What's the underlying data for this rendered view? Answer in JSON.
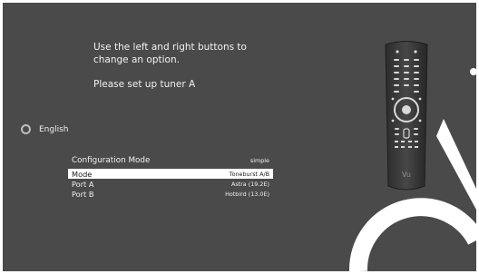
{
  "instructions": {
    "line1": "Use the left and right buttons to",
    "line2": "change an option.",
    "tuner_prompt": "Please set up tuner A"
  },
  "language": {
    "label": "English",
    "icon": "radio-icon"
  },
  "config": {
    "rows": [
      {
        "label": "Configuration Mode",
        "value": "simple"
      },
      {
        "label": "Mode",
        "value": "Toneburst A/B"
      },
      {
        "label": "Port A",
        "value": "Astra (19.2E)"
      },
      {
        "label": "Port B",
        "value": "Hotbird (13.0E)"
      }
    ],
    "selected_index": 1
  },
  "remote": {
    "icon": "remote-control-icon",
    "brand_mark": "Vu"
  },
  "colors": {
    "background": "#4a4a4a",
    "text": "#f0f0f0",
    "selection": "#ffffff"
  }
}
